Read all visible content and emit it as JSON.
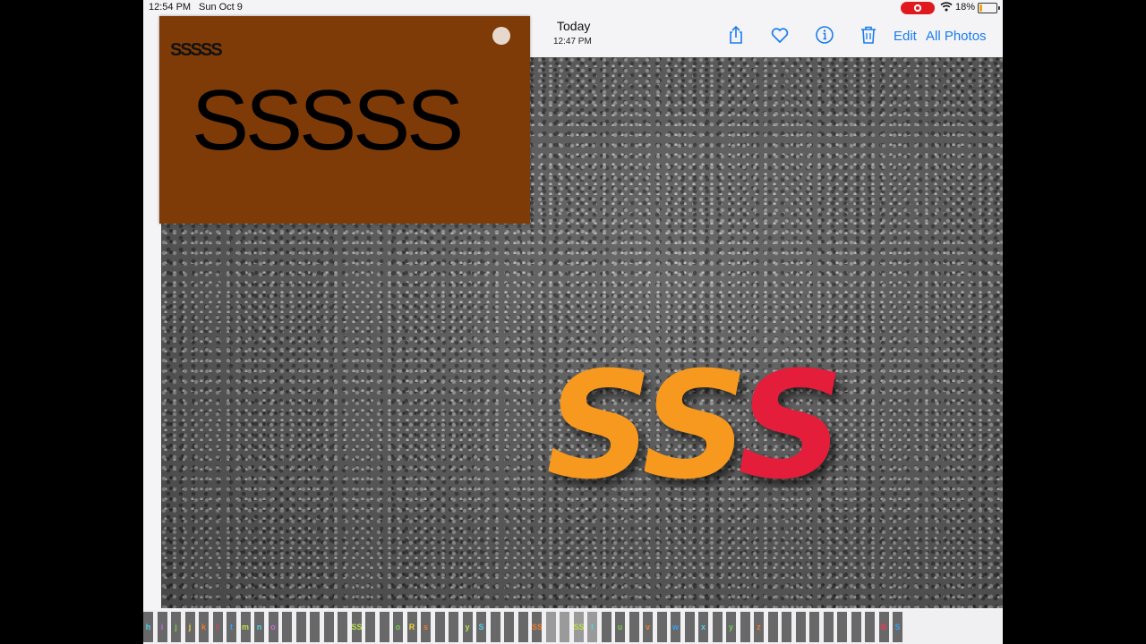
{
  "status_bar": {
    "time": "12:54 PM",
    "date": "Sun Oct 9",
    "battery_pct": "18%",
    "battery_level": 0.18,
    "recording": true
  },
  "header": {
    "title": "Today",
    "time": "12:47 PM",
    "edit": "Edit",
    "all_photos": "All Photos",
    "icons": [
      "share-icon",
      "heart-icon",
      "info-icon",
      "trash-icon"
    ]
  },
  "pip": {
    "small_text": "SSSSS",
    "large_text": "SSSSS",
    "bg": "#7f3b07"
  },
  "photo": {
    "letters": [
      "S",
      "S",
      "S"
    ],
    "letter_colors": [
      "#f7991e",
      "#f7991e",
      "#e41e3a"
    ]
  },
  "colors": {
    "accent": "#1a7cf0",
    "record": "#e0191f"
  },
  "filmstrip": {
    "thumbs": [
      "h",
      "i",
      "j",
      "j",
      "k",
      "l",
      "t",
      "m",
      "n",
      "o",
      "",
      "",
      "",
      "",
      "",
      "SS",
      "",
      "",
      "o",
      "R",
      "s",
      "",
      "",
      "y",
      "S",
      "",
      "",
      "",
      "SS",
      "",
      "",
      "SS",
      "t",
      "",
      "u",
      "",
      "v",
      "",
      "w",
      "",
      "x",
      "",
      "y",
      "",
      "z",
      "",
      "",
      "",
      "",
      "",
      "",
      "",
      "",
      "B",
      "S"
    ]
  }
}
